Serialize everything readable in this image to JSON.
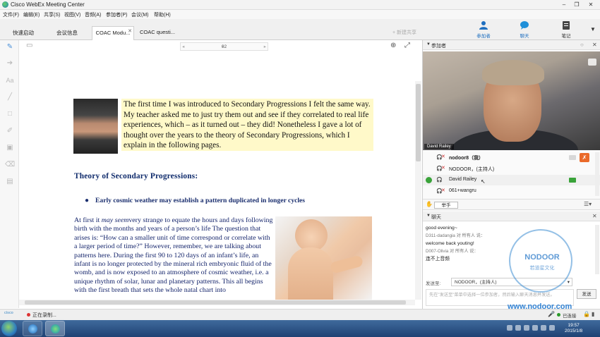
{
  "window": {
    "title": "Cisco WebEx Meeting Center"
  },
  "menu": [
    "文件(F)",
    "编辑(E)",
    "共享(S)",
    "视图(V)",
    "音频(A)",
    "参加者(P)",
    "会议(M)",
    "帮助(H)"
  ],
  "tabs": [
    {
      "label": "快速启动",
      "active": false
    },
    {
      "label": "会议信息",
      "active": false
    },
    {
      "label": "COAC Modu...",
      "active": true
    },
    {
      "label": "COAC questi...",
      "active": false
    }
  ],
  "share_label": "+ 新建共享",
  "top_icons": [
    {
      "label": "参加者",
      "icon": "participants-icon"
    },
    {
      "label": "聊天",
      "icon": "chat-icon"
    },
    {
      "label": "笔记",
      "icon": "notes-icon"
    }
  ],
  "viewer": {
    "page_number": "02",
    "intro_text": "The first time I was introduced to Secondary Progressions I felt the same way.  My teacher asked me to just try them out and see if they correlated to real life experiences, which – as it turned out – they did! Nonetheless I gave a lot of thought over the years to the theory of Secondary Progressions, which I explain in the following pages.",
    "heading": "Theory of Secondary Progressions:",
    "bullet": "Early cosmic weather may establish a pattern duplicated in longer cycles",
    "body_lead": "At first it ",
    "body_italic": "may seem",
    "body_rest": "very strange to equate the hours and days following birth with the months and years of a person’s life The question that arises is: “How can a smaller unit of time correspond or correlate with a larger period of time?”  However, remember, we are talking about patterns here.  During the first 90 to 120 days of an infant’s life, an infant is no longer protected by the mineral rich embryonic fluid of the womb, and is now exposed to an atmosphere of cosmic weather, i.e. a unique rhythm of solar, lunar and planetary patterns.  This all begins with the first breath that sets the whole natal chart into"
  },
  "participants_panel": {
    "title": "参加者",
    "video_label": "David Railey",
    "rows": [
      {
        "name": "nodoor8（我）",
        "bold": true,
        "muted": true,
        "cam": "off",
        "orange": true
      },
      {
        "name": "NODOOR，(主持人)",
        "bold": false,
        "muted": true,
        "cam": "none",
        "orange": false
      },
      {
        "name": "David Railey",
        "bold": false,
        "muted": false,
        "cam": "on",
        "orange": false,
        "presenter": true
      },
      {
        "name": "061+wangru",
        "bold": false,
        "muted": true,
        "cam": "none",
        "orange": false
      }
    ],
    "raise_hand": "举手"
  },
  "chat_panel": {
    "title": "聊天",
    "messages": [
      {
        "type": "text",
        "text": "good evening~"
      },
      {
        "type": "from",
        "text": "D311-dadangia 对 所有人 说："
      },
      {
        "type": "text",
        "text": "welcome back youting!"
      },
      {
        "type": "from",
        "text": "D007-Olivia 对 所有人 说："
      },
      {
        "type": "text",
        "text": "连不上音频"
      }
    ],
    "send_to_label": "发送至:",
    "send_to_value": "NODOOR，(主持人)",
    "input_placeholder": "先在\"发送至\"菜单中选择一位参加者，然后输入聊天消息并发送。",
    "send_button": "发送"
  },
  "watermark": {
    "title": "NODOOR",
    "subtitle": "若道星文化",
    "url": "www.nodoor.com"
  },
  "status": {
    "recording": "正在录制...",
    "connection": "已连接",
    "cisco": "cisco"
  },
  "taskbar": {
    "time": "19:57",
    "date": "2015/1/8"
  }
}
